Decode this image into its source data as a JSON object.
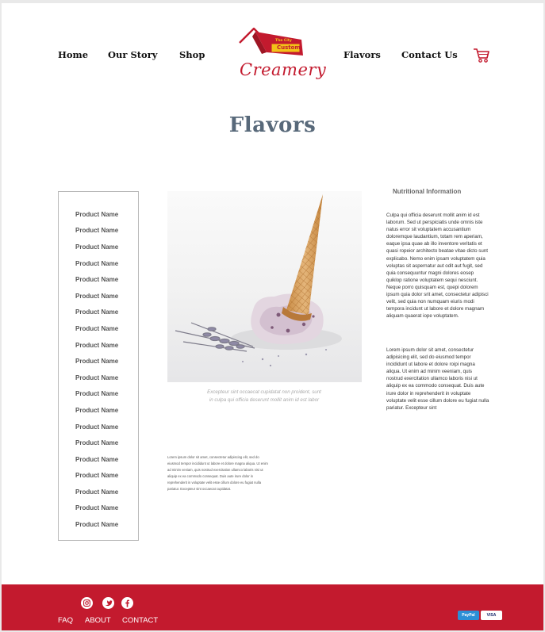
{
  "nav": {
    "home": "Home",
    "our_story": "Our Story",
    "shop": "Shop",
    "flavors": "Flavors",
    "contact": "Contact Us"
  },
  "logo": {
    "small_text": "The City",
    "badge_text": "Custom",
    "script_text": "Creamery"
  },
  "page_title": "Flavors",
  "products": [
    "Product Name",
    "Product Name",
    "Product Name",
    "Product Name",
    "Product Name",
    "Product Name",
    "Product Name",
    "Product Name",
    "Product Name",
    "Product Name",
    "Product Name",
    "Product Name",
    "Product Name",
    "Product Name",
    "Product Name",
    "Product Name",
    "Product Name",
    "Product Name",
    "Product Name",
    "Product Name"
  ],
  "image_caption": "Excepteur sint occaecat cupidatat non proident, sunt in culpa qui officia deserunt mollit anim id est labor",
  "small_text": "Lorem ipsum dolor sit amet, consectetur adipiscing elit, sed do eiusmod tempor incididunt ut labore et dolore magna aliqua. Ut enim ad minim veniam, quis nostrud exercitation ullamco laboris nisi ut aliquip ex ea commodo consequat. Duis aute irure dolor in reprehenderit in voluptate velit esse cillum dolore eu fugiat nulla pariatur. Excepteur sint occaecat cupidatat.",
  "nutrition": {
    "title": "Nutritional Information",
    "para1": "Culpa qui officia deserunt mollit anim id est laborum. Sed ut perspiciatis unde omnis iste natus error sit voluptatem accusantium doloremque laudantium, totam rem aperiam, eaque ipsa quae ab illo inventore veritatis et quasi ropeior architecto beatae vitae dicto sunt explicabo. Nemo enim ipsam voluptatem quia voluptas sit aspernatur aut odit aut fugit, sed quia consequuntur magni dolores eosep quiklop ratione voluptatem sequi nesciunt. Neque porro quisquam est, quepi dolorem ipsum quia dolor srit amet, consectetur adipisci velit, sed quia non numquam eiuris modi tempora incidunt ut labore et dolore magnam aliquam quaerat iope voluptatem.",
    "para2": "Lorem ipsum dolor sit amet, consectetur adipisicing elit, sed do eiusmod tempor incididunt ut labore et dolore roipi magna aliqua. Ut enim ad minim veeniam, quis nostrud exercitation ullamco laboris nisi ut aliquip ex ea commodo consequat. Duis aute irure dolor in reprehenderit in voluptate voluptate velit esse cillum dolore eu fugiat nulla pariatur. Excepteur sint"
  },
  "footer": {
    "faq": "FAQ",
    "about": "ABOUT",
    "contact": "CONTACT",
    "paypal": "PayPal",
    "visa": "VISA"
  },
  "colors": {
    "brand_red": "#c31a2e",
    "title_slate": "#58697a"
  }
}
